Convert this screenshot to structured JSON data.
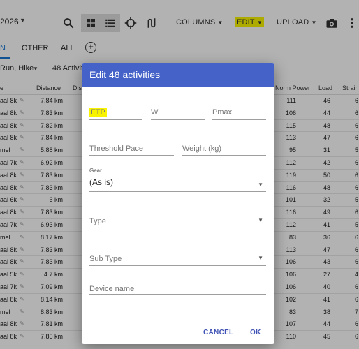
{
  "topbar": {
    "year_fragment": "2026",
    "menus": {
      "columns": "COLUMNS",
      "edit": "EDIT",
      "upload": "UPLOAD"
    }
  },
  "tabs": {
    "active_fragment": "N",
    "other": "OTHER",
    "all": "ALL",
    "add": "+"
  },
  "filters": {
    "sport_fragment": "Run, Hike",
    "count_fragment": "48 Activit"
  },
  "table": {
    "headers": {
      "name_fragment": "e",
      "distance": "Distance",
      "dist2_fragment": "Dis",
      "norm_power": "Norm Power",
      "load": "Load",
      "strain_fragment": "Strain"
    },
    "rows": [
      {
        "name": "aal 8k",
        "distance": "7.84 km",
        "np": "111",
        "load": "46",
        "strain": "6"
      },
      {
        "name": "aal 8k",
        "distance": "7.83 km",
        "np": "106",
        "load": "44",
        "strain": "6"
      },
      {
        "name": "aal 8k",
        "distance": "7.82 km",
        "np": "115",
        "load": "48",
        "strain": "6"
      },
      {
        "name": "aal 8k",
        "distance": "7.84 km",
        "np": "113",
        "load": "47",
        "strain": "6"
      },
      {
        "name": "mel",
        "distance": "5.88 km",
        "np": "95",
        "load": "31",
        "strain": "5"
      },
      {
        "name": "aal 7k",
        "distance": "6.92 km",
        "np": "112",
        "load": "42",
        "strain": "6"
      },
      {
        "name": "aal 8k",
        "distance": "7.83 km",
        "np": "119",
        "load": "50",
        "strain": "6"
      },
      {
        "name": "aal 8k",
        "distance": "7.83 km",
        "np": "116",
        "load": "48",
        "strain": "6"
      },
      {
        "name": "aal 6k",
        "distance": "6 km",
        "np": "101",
        "load": "32",
        "strain": "5"
      },
      {
        "name": "aal 8k",
        "distance": "7.83 km",
        "np": "116",
        "load": "49",
        "strain": "6"
      },
      {
        "name": "aal 7k",
        "distance": "6.93 km",
        "np": "112",
        "load": "41",
        "strain": "5"
      },
      {
        "name": "mel",
        "distance": "8.17 km",
        "np": "83",
        "load": "36",
        "strain": "6"
      },
      {
        "name": "aal 8k",
        "distance": "7.83 km",
        "np": "113",
        "load": "47",
        "strain": "6"
      },
      {
        "name": "aal 8k",
        "distance": "7.83 km",
        "np": "106",
        "load": "43",
        "strain": "6"
      },
      {
        "name": "aal 5k",
        "distance": "4.7 km",
        "np": "106",
        "load": "27",
        "strain": "4"
      },
      {
        "name": "aal 7k",
        "distance": "7.09 km",
        "np": "106",
        "load": "40",
        "strain": "6"
      },
      {
        "name": "aal 8k",
        "distance": "8.14 km",
        "np": "102",
        "load": "41",
        "strain": "6"
      },
      {
        "name": "mel",
        "distance": "8.83 km",
        "np": "83",
        "load": "38",
        "strain": "7"
      },
      {
        "name": "aal 8k",
        "distance": "7.81 km",
        "np": "107",
        "load": "44",
        "strain": "6"
      },
      {
        "name": "aal 8k",
        "distance": "7.85 km",
        "np": "110",
        "load": "45",
        "strain": "6"
      }
    ]
  },
  "dialog": {
    "title": "Edit 48 activities",
    "fields": {
      "ftp": "FTP",
      "w_prime": "W'",
      "pmax": "Pmax",
      "threshold_pace": "Threshold Pace",
      "weight": "Weight (kg)",
      "gear_label": "Gear",
      "gear_value": "(As is)",
      "type": "Type",
      "sub_type": "Sub Type",
      "device_name": "Device name"
    },
    "buttons": {
      "cancel": "CANCEL",
      "ok": "OK"
    }
  },
  "colors": {
    "header": "#4462c8",
    "highlight": "#f8f400",
    "accent": "#1976d2",
    "button_text": "#3f51b5"
  }
}
